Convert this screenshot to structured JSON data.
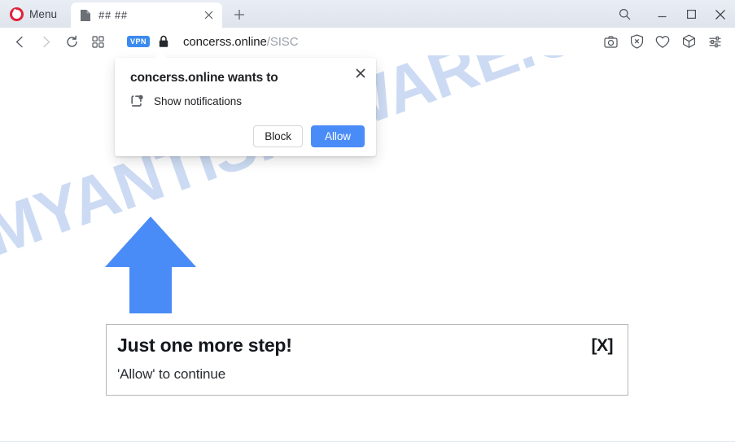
{
  "browser": {
    "menu_label": "Menu",
    "logo_icon": "opera-logo-icon",
    "tab": {
      "title": "## ##",
      "favicon_icon": "page-document-icon",
      "close_icon": "close-icon"
    },
    "new_tab_icon": "plus-icon",
    "window_controls": [
      {
        "name": "search-icon",
        "label": "Search"
      },
      {
        "name": "minimize-icon",
        "label": "Minimize"
      },
      {
        "name": "maximize-icon",
        "label": "Maximize"
      },
      {
        "name": "close-window-icon",
        "label": "Close"
      }
    ],
    "navigation": [
      {
        "name": "back-icon",
        "label": "Back",
        "enabled": true
      },
      {
        "name": "forward-icon",
        "label": "Forward",
        "enabled": false
      },
      {
        "name": "reload-icon",
        "label": "Reload",
        "enabled": true
      },
      {
        "name": "speed-dial-icon",
        "label": "Speed Dial",
        "enabled": true
      }
    ],
    "address": {
      "vpn_badge": "VPN",
      "lock_icon": "lock-icon",
      "host": "concerss.online",
      "path": "/SISC",
      "full_url": "concerss.online/SISC"
    },
    "toolbar_right": [
      {
        "name": "snapshot-camera-icon",
        "label": "Snapshot"
      },
      {
        "name": "ad-blocker-shield-icon",
        "label": "Ad blocker"
      },
      {
        "name": "heart-icon",
        "label": "Save to favorites"
      },
      {
        "name": "crypto-wallet-cube-icon",
        "label": "Crypto Wallet"
      },
      {
        "name": "easy-setup-sliders-icon",
        "label": "Easy setup"
      }
    ]
  },
  "permission_popup": {
    "title": "concerss.online wants to",
    "request_icon": "notification-bell-icon",
    "request_text": "Show notifications",
    "close_icon": "close-icon",
    "block_label": "Block",
    "allow_label": "Allow",
    "allow_color": "#4a8cf7"
  },
  "page": {
    "watermark": "MYANTISPYWARE.COM",
    "watermark_color": "#ccdbf3",
    "arrow_icon": "up-arrow-icon",
    "arrow_color": "#4a8cf7",
    "notice": {
      "title": "Just one more step!",
      "subtitle": "'Allow' to continue",
      "close_label": "[X]"
    }
  }
}
